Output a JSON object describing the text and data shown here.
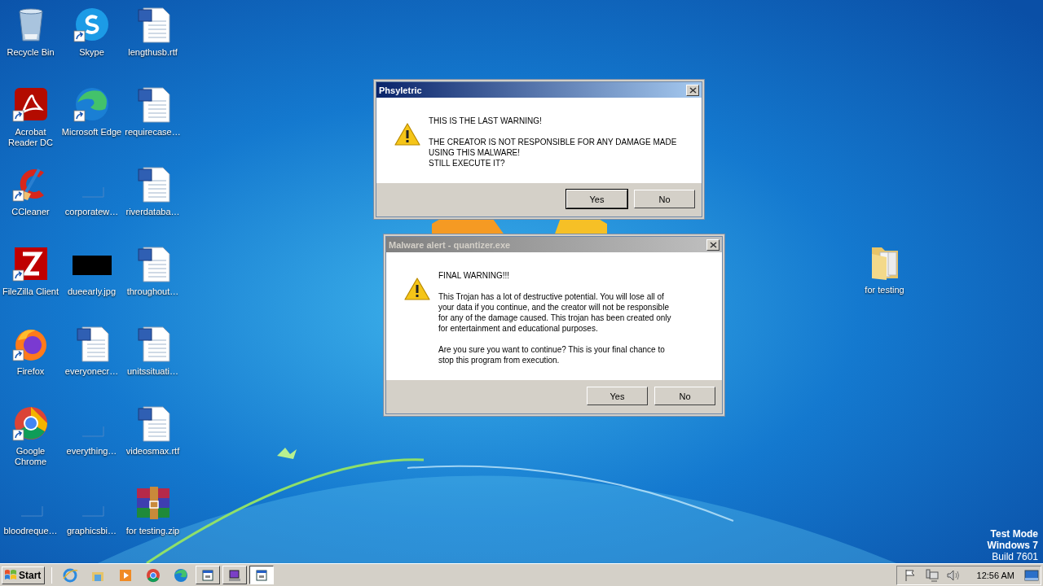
{
  "desktop": {
    "icons": [
      {
        "label": "Recycle Bin",
        "kind": "recycle",
        "shortcut": false
      },
      {
        "label": "Acrobat Reader DC",
        "kind": "pdf",
        "shortcut": true
      },
      {
        "label": "CCleaner",
        "kind": "cleaner",
        "shortcut": true
      },
      {
        "label": "FileZilla Client",
        "kind": "ftp",
        "shortcut": true
      },
      {
        "label": "Firefox",
        "kind": "firefox",
        "shortcut": true
      },
      {
        "label": "Google Chrome",
        "kind": "chrome",
        "shortcut": true
      },
      {
        "label": "bloodreque…",
        "kind": "blank",
        "shortcut": false
      },
      {
        "label": "Skype",
        "kind": "skype",
        "shortcut": true
      },
      {
        "label": "Microsoft Edge",
        "kind": "edge",
        "shortcut": true
      },
      {
        "label": "corporatew…",
        "kind": "blank",
        "shortcut": false
      },
      {
        "label": "dueearly.jpg",
        "kind": "image",
        "shortcut": false
      },
      {
        "label": "everyonecr…",
        "kind": "word",
        "shortcut": false
      },
      {
        "label": "everything…",
        "kind": "blank",
        "shortcut": false
      },
      {
        "label": "graphicsbi…",
        "kind": "blank",
        "shortcut": false
      },
      {
        "label": "lengthusb.rtf",
        "kind": "word",
        "shortcut": false
      },
      {
        "label": "requirecase…",
        "kind": "word",
        "shortcut": false
      },
      {
        "label": "riverdataba…",
        "kind": "word",
        "shortcut": false
      },
      {
        "label": "throughout…",
        "kind": "word",
        "shortcut": false
      },
      {
        "label": "unitssituati…",
        "kind": "word",
        "shortcut": false
      },
      {
        "label": "videosmax.rtf",
        "kind": "word",
        "shortcut": false
      },
      {
        "label": "for testing.zip",
        "kind": "archive",
        "shortcut": false
      }
    ],
    "side_icon": {
      "label": "for testing",
      "kind": "folder",
      "shortcut": false
    },
    "system_text": [
      "Test Mode",
      "Windows 7",
      "Build 7601"
    ]
  },
  "dialogs": [
    {
      "title": "Phsyletric",
      "active": true,
      "paragraphs": [
        "THIS IS THE LAST WARNING!",
        "THE CREATOR IS NOT RESPONSIBLE FOR ANY DAMAGE MADE\nUSING THIS MALWARE!\nSTILL EXECUTE IT?"
      ],
      "buttons": [
        {
          "label": "Yes",
          "default": true
        },
        {
          "label": "No",
          "default": false
        }
      ]
    },
    {
      "title": "Malware alert - quantizer.exe",
      "active": false,
      "paragraphs": [
        "FINAL WARNING!!!",
        "This Trojan has a lot of destructive potential. You will lose all of\nyour data if you continue, and the creator will not be responsible\nfor any of the damage caused. This trojan has been created only\nfor entertainment and educational purposes.",
        "Are you sure you want to continue? This is your final chance to\nstop this program from execution."
      ],
      "buttons": [
        {
          "label": "Yes",
          "default": false
        },
        {
          "label": "No",
          "default": false
        }
      ]
    }
  ],
  "taskbar": {
    "start": "Start",
    "quick_launch": [
      {
        "kind": "ie"
      },
      {
        "kind": "explorer"
      },
      {
        "kind": "media"
      },
      {
        "kind": "chrome"
      },
      {
        "kind": "edge"
      }
    ],
    "tasks": [
      {
        "kind": "window",
        "selected": false
      },
      {
        "kind": "monitor",
        "selected": false
      },
      {
        "kind": "window",
        "selected": true
      }
    ],
    "tray": [
      {
        "kind": "flag"
      },
      {
        "kind": "network"
      },
      {
        "kind": "volume"
      }
    ],
    "clock": "12:56 AM"
  }
}
